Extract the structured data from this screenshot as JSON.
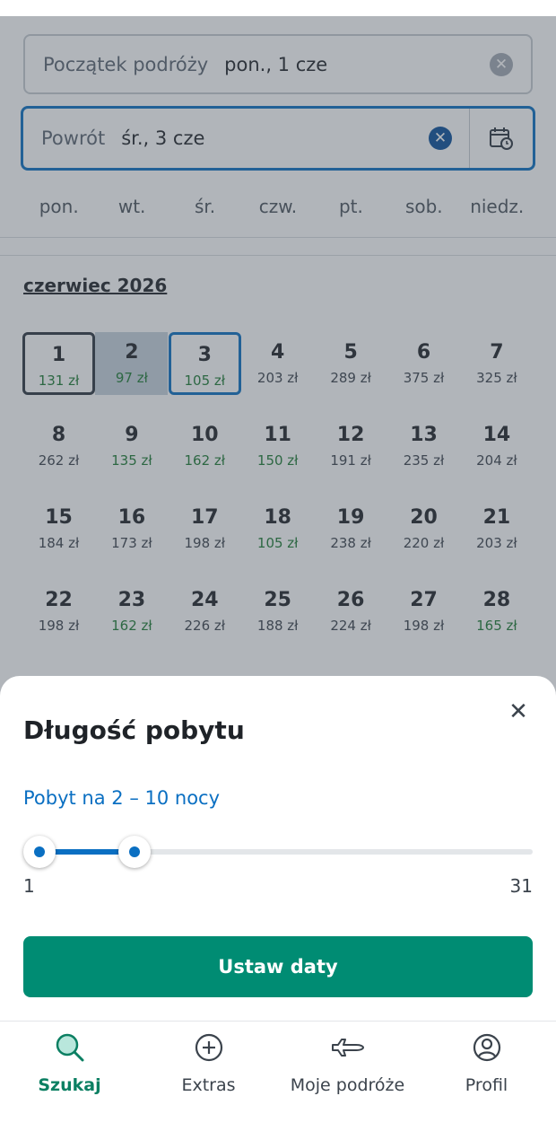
{
  "search": {
    "start": {
      "label": "Początek podróży",
      "value": "pon., 1 cze",
      "clear_icon": "clear-icon"
    },
    "return": {
      "label": "Powrót",
      "value": "śr., 3 cze",
      "clear_icon": "clear-icon",
      "calendar_icon": "calendar-clock-icon"
    }
  },
  "weekdays": [
    "pon.",
    "wt.",
    "śr.",
    "czw.",
    "pt.",
    "sob.",
    "niedz."
  ],
  "month": "czerwiec 2026",
  "days": [
    {
      "num": "1",
      "price": "131 zł",
      "cheap": true,
      "state": "start"
    },
    {
      "num": "2",
      "price": "97 zł",
      "cheap": true,
      "state": "range"
    },
    {
      "num": "3",
      "price": "105 zł",
      "cheap": true,
      "state": "end"
    },
    {
      "num": "4",
      "price": "203 zł",
      "cheap": false
    },
    {
      "num": "5",
      "price": "289 zł",
      "cheap": false
    },
    {
      "num": "6",
      "price": "375 zł",
      "cheap": false
    },
    {
      "num": "7",
      "price": "325 zł",
      "cheap": false
    },
    {
      "num": "8",
      "price": "262 zł",
      "cheap": false
    },
    {
      "num": "9",
      "price": "135 zł",
      "cheap": true
    },
    {
      "num": "10",
      "price": "162 zł",
      "cheap": true
    },
    {
      "num": "11",
      "price": "150 zł",
      "cheap": true
    },
    {
      "num": "12",
      "price": "191 zł",
      "cheap": false
    },
    {
      "num": "13",
      "price": "235 zł",
      "cheap": false
    },
    {
      "num": "14",
      "price": "204 zł",
      "cheap": false
    },
    {
      "num": "15",
      "price": "184 zł",
      "cheap": false
    },
    {
      "num": "16",
      "price": "173 zł",
      "cheap": false
    },
    {
      "num": "17",
      "price": "198 zł",
      "cheap": false
    },
    {
      "num": "18",
      "price": "105 zł",
      "cheap": true
    },
    {
      "num": "19",
      "price": "238 zł",
      "cheap": false
    },
    {
      "num": "20",
      "price": "220 zł",
      "cheap": false
    },
    {
      "num": "21",
      "price": "203 zł",
      "cheap": false
    },
    {
      "num": "22",
      "price": "198 zł",
      "cheap": false
    },
    {
      "num": "23",
      "price": "162 zł",
      "cheap": true
    },
    {
      "num": "24",
      "price": "226 zł",
      "cheap": false
    },
    {
      "num": "25",
      "price": "188 zł",
      "cheap": false
    },
    {
      "num": "26",
      "price": "224 zł",
      "cheap": false
    },
    {
      "num": "27",
      "price": "198 zł",
      "cheap": false
    },
    {
      "num": "28",
      "price": "165 zł",
      "cheap": true
    }
  ],
  "sheet": {
    "title": "Długość pobytu",
    "range_label": "Pobyt na 2 – 10 nocy",
    "slider": {
      "min": 1,
      "max": 31,
      "low": 2,
      "high": 10
    },
    "min_label": "1",
    "max_label": "31",
    "cta": "Ustaw daty"
  },
  "tabs": [
    {
      "label": "Szukaj",
      "icon": "search-icon",
      "active": true
    },
    {
      "label": "Extras",
      "icon": "plus-circle-icon",
      "active": false
    },
    {
      "label": "Moje podróże",
      "icon": "plane-icon",
      "active": false
    },
    {
      "label": "Profil",
      "icon": "profile-icon",
      "active": false
    }
  ],
  "colors": {
    "accent": "#0a6fc2",
    "cta": "#008c73",
    "cheap": "#1d7a33",
    "active_tab": "#0b7f62"
  }
}
